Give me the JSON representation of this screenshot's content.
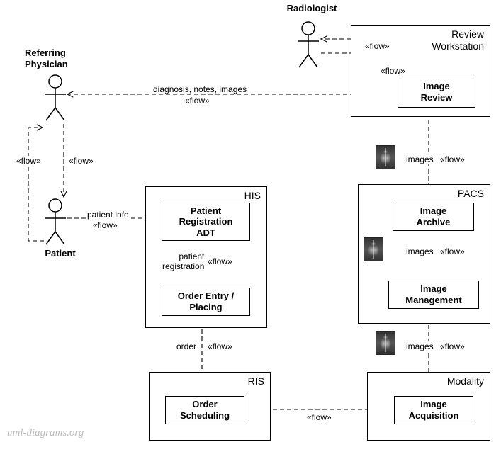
{
  "actors": {
    "radiologist": "Radiologist",
    "referring_physician": "Referring\nPhysician",
    "patient": "Patient"
  },
  "containers": {
    "review_ws": {
      "title": "Review\nWorkstation",
      "inner": {
        "image_review": "Image\nReview"
      }
    },
    "his": {
      "title": "HIS",
      "inner": {
        "patient_reg": "Patient\nRegistration\nADT",
        "order_entry": "Order Entry /\nPlacing"
      }
    },
    "pacs": {
      "title": "PACS",
      "inner": {
        "image_archive": "Image\nArchive",
        "image_mgmt": "Image\nManagement"
      }
    },
    "ris": {
      "title": "RIS",
      "inner": {
        "order_sched": "Order\nScheduling"
      }
    },
    "modality": {
      "title": "Modality",
      "inner": {
        "image_acq": "Image\nAcquisition"
      }
    }
  },
  "flows": {
    "diag": {
      "label": "diagnosis, notes, images",
      "stereo": "«flow»"
    },
    "refphys_patient1": {
      "stereo": "«flow»"
    },
    "refphys_patient2": {
      "stereo": "«flow»"
    },
    "patient_info": {
      "label": "patient info",
      "stereo": "«flow»"
    },
    "patient_reg_flow": {
      "label": "patient\nregistration",
      "stereo": "«flow»"
    },
    "order_flow": {
      "label": "order",
      "stereo": "«flow»"
    },
    "ris_modality": {
      "stereo": "«flow»"
    },
    "mod_pacs": {
      "label": "images",
      "stereo": "«flow»"
    },
    "pacs_internal": {
      "label": "images",
      "stereo": "«flow»"
    },
    "pacs_review": {
      "label": "images",
      "stereo": "«flow»"
    },
    "review_radiologist1": {
      "stereo": "«flow»"
    },
    "review_radiologist2": {
      "stereo": "«flow»"
    }
  },
  "watermark": "uml-diagrams.org"
}
